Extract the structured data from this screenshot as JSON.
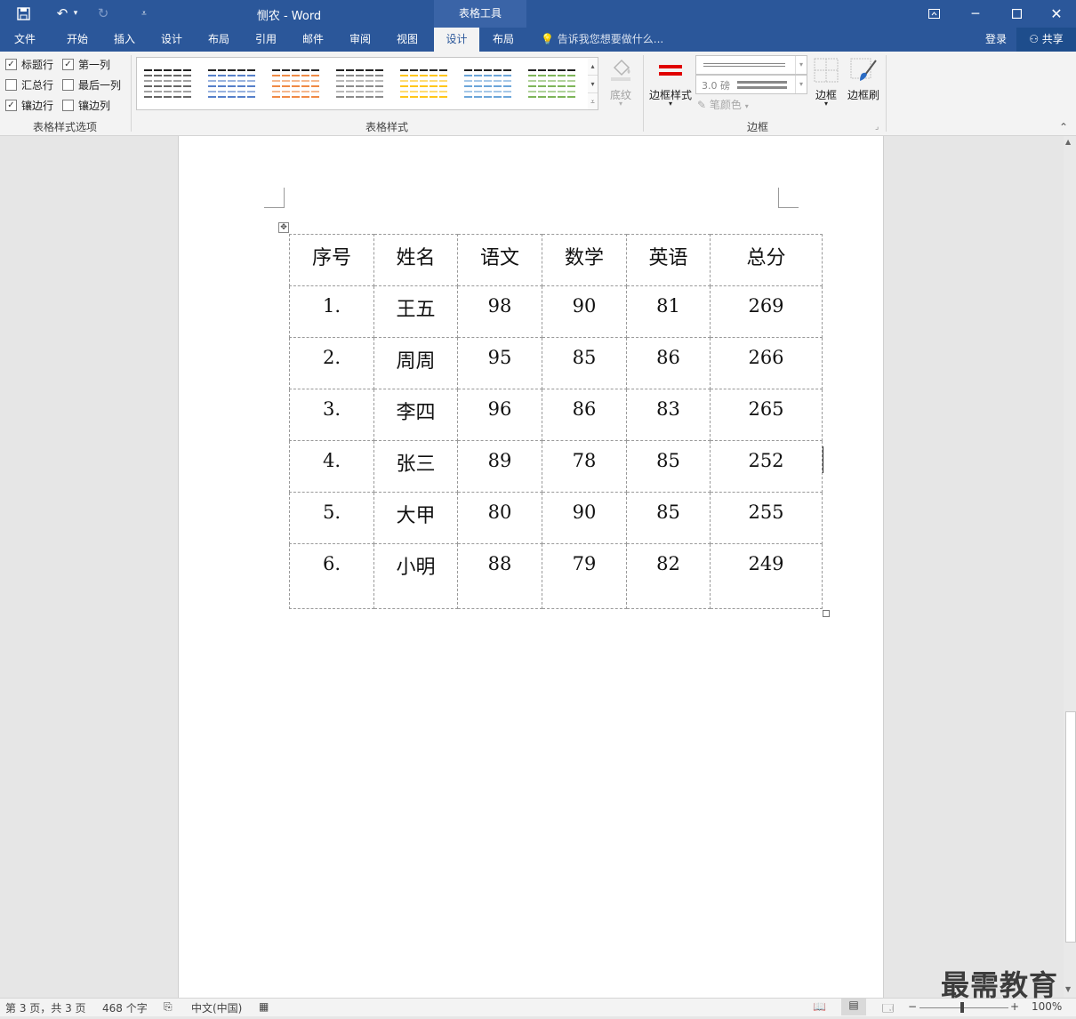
{
  "titlebar": {
    "title": "恻农 - Word",
    "contextual_tab": "表格工具"
  },
  "tabs": [
    {
      "label": "文件"
    },
    {
      "label": "开始"
    },
    {
      "label": "插入"
    },
    {
      "label": "设计"
    },
    {
      "label": "布局"
    },
    {
      "label": "引用"
    },
    {
      "label": "邮件"
    },
    {
      "label": "审阅"
    },
    {
      "label": "视图"
    },
    {
      "label": "设计",
      "active": true
    },
    {
      "label": "布局"
    }
  ],
  "tell_me": "告诉我您想要做什么...",
  "account": {
    "login": "登录",
    "share": "共享"
  },
  "ribbon": {
    "style_options": {
      "header_row": "标题行",
      "first_column": "第一列",
      "total_row": "汇总行",
      "last_column": "最后一列",
      "banded_rows": "镶边行",
      "banded_columns": "镶边列",
      "group_label": "表格样式选项"
    },
    "styles_group_label": "表格样式",
    "shading_label": "底纹",
    "border_styles_label": "边框样式",
    "pen_weight": "3.0 磅",
    "pen_color_label": "笔颜色",
    "borders_label": "边框",
    "border_painter_label": "边框刷",
    "borders_group_label": "边框",
    "swatch_colors": [
      "#555555",
      "#4472c4",
      "#ed7d31",
      "#7f7f7f",
      "#ffc000",
      "#5b9bd5",
      "#70ad47"
    ]
  },
  "table": {
    "headers": [
      "序号",
      "姓名",
      "语文",
      "数学",
      "英语",
      "总分"
    ],
    "rows": [
      [
        "1.",
        "王五",
        "98",
        "90",
        "81",
        "269"
      ],
      [
        "2.",
        "周周",
        "95",
        "85",
        "86",
        "266"
      ],
      [
        "3.",
        "李四",
        "96",
        "86",
        "83",
        "265"
      ],
      [
        "4.",
        "张三",
        "89",
        "78",
        "85",
        "252"
      ],
      [
        "5.",
        "大甲",
        "80",
        "90",
        "85",
        "255"
      ],
      [
        "6.",
        "小明",
        "88",
        "79",
        "82",
        "249"
      ]
    ]
  },
  "statusbar": {
    "page": "第 3 页，共 3 页",
    "words": "468 个字",
    "language": "中文(中国)",
    "zoom": "100%"
  },
  "watermark": "最需教育"
}
